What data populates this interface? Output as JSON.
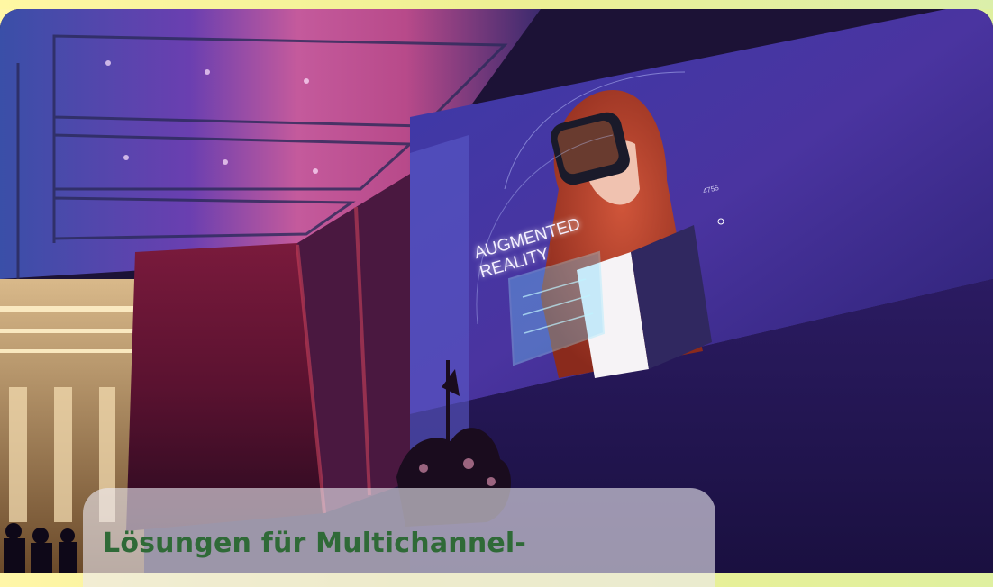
{
  "headline": "Lösungen für Multichannel-",
  "projection": {
    "title_line1": "AUGMENTED",
    "title_line2": "REALITY",
    "readout": "4755"
  }
}
